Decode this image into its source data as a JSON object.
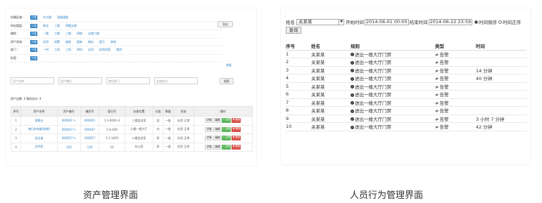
{
  "left": {
    "filters": [
      {
        "label": "所属区域:",
        "values": [
          "大楼",
          "东大楼",
          "西楼裙楼"
        ]
      },
      {
        "label": "所在楼层:",
        "values": [
          "大楼",
          "南北",
          "三楼",
          "四楼五楼"
        ]
      },
      {
        "label": "楼栋 :",
        "values": [
          "大楼",
          "一楼",
          "二楼",
          "三楼",
          "四楼",
          "五楼六楼"
        ]
      },
      {
        "label": "资产状态:",
        "values": [
          "大楼",
          "在用",
          "闲置",
          "维修",
          "报废",
          "借出",
          "盘亏",
          "其他"
        ]
      },
      {
        "label": "部门 :",
        "values": [
          "大楼",
          "一科",
          "二科",
          "三科",
          "四科",
          "五科",
          "综合科室",
          "其他"
        ]
      },
      {
        "label": "标签 :",
        "values": [
          "大楼"
        ]
      }
    ],
    "fold_link": "收起",
    "top_button": "导出",
    "search_placeholders": [
      "资产名称",
      "资产编号",
      "使用部门",
      "存放地点"
    ],
    "search_button": "搜索",
    "stats": "资产总数: 4   我的总计: 4",
    "table": {
      "headers": [
        "序号",
        "资产名称",
        "资产编号",
        "编目号",
        "登记号",
        "存放位置",
        "分类",
        "数量",
        "状态",
        "操作"
      ],
      "rows": [
        {
          "no": "1",
          "name": "投影仪",
          "code": "000001 ✎",
          "catalog": "000001",
          "reg": "1-1-0001-4",
          "place": "三楼会议室",
          "cat": "设",
          "qty": "一批",
          "status": "在用 正常"
        },
        {
          "no": "2",
          "name": "笔记本电脑(联想)",
          "code": "000047 ✎",
          "catalog": "000047",
          "reg": "1-4-029",
          "place": "大楼一楼大厅",
          "cat": "办",
          "qty": "一批",
          "status": "在用 正常"
        },
        {
          "no": "3",
          "name": "会议桌",
          "code": "000057 ✎",
          "catalog": "000057",
          "reg": "1-1-1403",
          "place": "二楼会议室",
          "cat": "家",
          "qty": "一批",
          "status": "在用 正常"
        },
        {
          "no": "4",
          "name": "文件柜",
          "code": "120",
          "catalog": "120",
          "reg": "12",
          "place": "办公室",
          "cat": "家",
          "qty": "一批",
          "status": "在用 正常"
        }
      ],
      "ops": [
        "详情",
        "编辑",
        "✓ 启用",
        "✖ 删除"
      ]
    }
  },
  "right": {
    "name_label": "姓名",
    "name_value": "关某某",
    "start_label": "开始时间",
    "start_value": "2014-06-01 00:00",
    "end_label": "结束时间",
    "end_value": "2014-06-22 23:59",
    "sort_options": [
      "时间倒序",
      "时间正序"
    ],
    "query_button": "查询",
    "headers": [
      "序号",
      "姓名",
      "规则",
      "类型",
      "时间"
    ],
    "rows": [
      {
        "no": "1",
        "name": "关某某",
        "rule": "进出一楼大厅门禁",
        "type": "告警",
        "time": ""
      },
      {
        "no": "2",
        "name": "关某某",
        "rule": "进出一楼大厅门禁",
        "type": "告警",
        "time": ""
      },
      {
        "no": "3",
        "name": "关某某",
        "rule": "进出一楼大厅门禁",
        "type": "告警",
        "time": "14 分钟"
      },
      {
        "no": "4",
        "name": "关某某",
        "rule": "进出一楼大厅门禁",
        "type": "告警",
        "time": "40 分钟"
      },
      {
        "no": "5",
        "name": "关某某",
        "rule": "进出一楼大厅门禁",
        "type": "告警",
        "time": ""
      },
      {
        "no": "6",
        "name": "关某某",
        "rule": "进出一楼大厅门禁",
        "type": "告警",
        "time": ""
      },
      {
        "no": "7",
        "name": "关某某",
        "rule": "进出一楼大厅门禁",
        "type": "告警",
        "time": ""
      },
      {
        "no": "8",
        "name": "关某某",
        "rule": "进出一楼大厅门禁",
        "type": "告警",
        "time": ""
      },
      {
        "no": "9",
        "name": "关某某",
        "rule": "进出一楼大厅门禁",
        "type": "告警",
        "time": "3 小时 7 分钟"
      },
      {
        "no": "10",
        "name": "关某某",
        "rule": "进出一楼大厅门禁",
        "type": "告警",
        "time": "42 分钟"
      }
    ]
  },
  "captions": {
    "left": "资产管理界面",
    "right": "人员行为管理界面"
  }
}
